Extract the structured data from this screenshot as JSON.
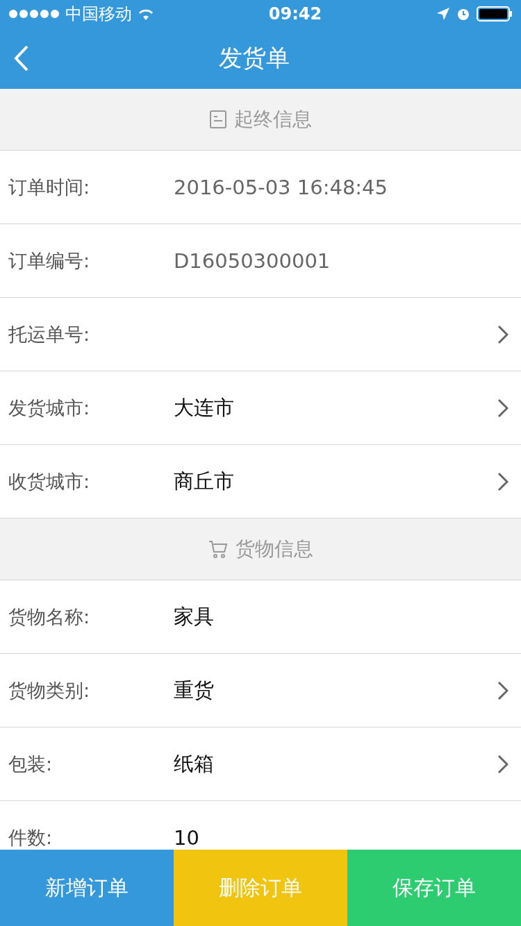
{
  "status_bar": {
    "carrier": "中国移动",
    "time": "09:42"
  },
  "nav": {
    "title": "发货单"
  },
  "sections": [
    {
      "title": "起终信息",
      "rows": [
        {
          "label": "订单时间:",
          "value": "2016-05-03 16:48:45",
          "disabled": true,
          "arrow": false
        },
        {
          "label": "订单编号:",
          "value": "D16050300001",
          "disabled": true,
          "arrow": false
        },
        {
          "label": "托运单号:",
          "arrow": true
        },
        {
          "label": "发货城市:",
          "value": "大连市",
          "disabled": false,
          "arrow": true
        },
        {
          "label": "收货城市:",
          "value": "商丘市",
          "disabled": false,
          "arrow": true
        }
      ]
    },
    {
      "title": "货物信息",
      "rows": [
        {
          "label": "货物名称:",
          "value": "家具",
          "disabled": false,
          "arrow": false
        },
        {
          "label": "货物类别:",
          "value": "重货",
          "disabled": false,
          "arrow": true
        },
        {
          "label": "包装:",
          "value": "纸箱",
          "disabled": false,
          "arrow": true
        },
        {
          "label": "件数:",
          "value": "10",
          "disabled": false,
          "arrow": false
        }
      ]
    }
  ],
  "buttons": [
    {
      "label": "新增订单",
      "color": "#3498db"
    },
    {
      "label": "删除订单",
      "color": "#f1c40f"
    },
    {
      "label": "保存订单",
      "color": "#2ecc71"
    }
  ]
}
